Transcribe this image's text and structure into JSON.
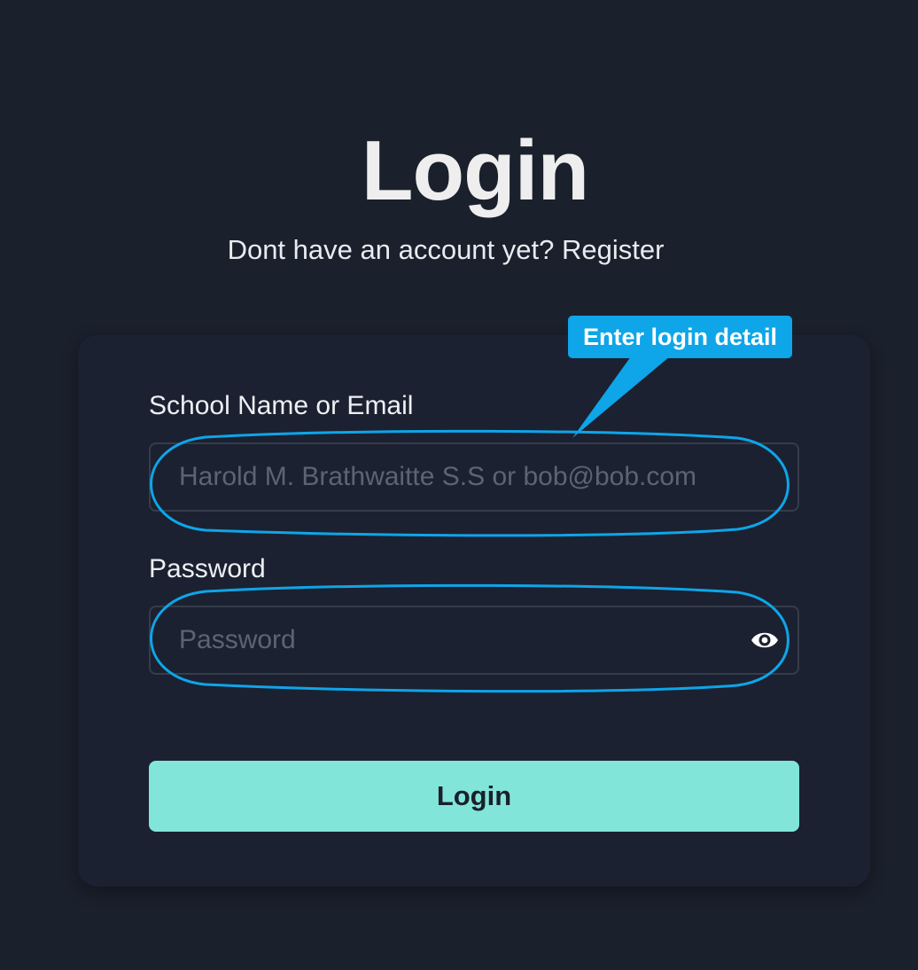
{
  "header": {
    "title": "Login",
    "subtitle_prefix": "Dont have an account yet? ",
    "register_link": "Register"
  },
  "form": {
    "identifier": {
      "label": "School Name or Email",
      "placeholder": "Harold M. Brathwaitte S.S or bob@bob.com",
      "value": ""
    },
    "password": {
      "label": "Password",
      "placeholder": "Password",
      "value": "",
      "toggle_icon": "eye-icon"
    },
    "submit_label": "Login"
  },
  "annotation": {
    "callout_text": "Enter login detail",
    "color": "#0ea5e9"
  },
  "colors": {
    "background": "#1a202c",
    "accent": "#81e6d9",
    "annotation": "#0ea5e9"
  }
}
